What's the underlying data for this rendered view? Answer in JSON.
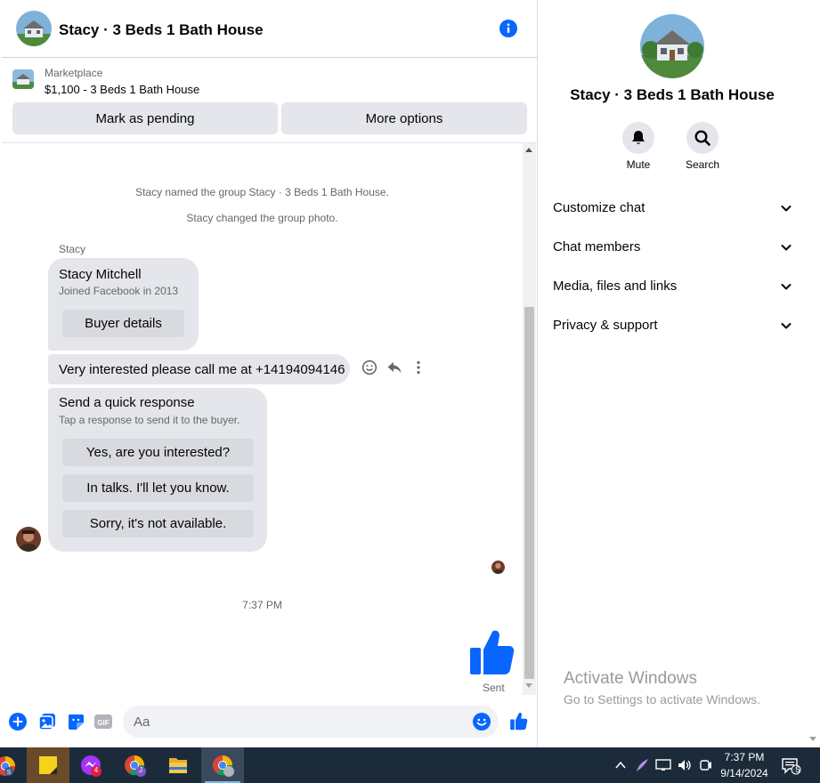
{
  "chat": {
    "title": "Stacy · 3 Beds 1 Bath House",
    "marketplace": {
      "label": "Marketplace",
      "listing": "$1,100 - 3 Beds 1 Bath House",
      "pending_label": "Mark as pending",
      "more_label": "More options"
    },
    "system_messages": [
      "Stacy named the group Stacy · 3 Beds 1 Bath House.",
      "Stacy changed the group photo."
    ],
    "sender_name": "Stacy",
    "profile_card": {
      "name": "Stacy Mitchell",
      "subtitle": "Joined Facebook in 2013",
      "button": "Buyer details"
    },
    "message_text": "Very interested please call me at +14194094146",
    "quick_response": {
      "title": "Send a quick response",
      "subtitle": "Tap a response to send it to the buyer.",
      "options": [
        "Yes, are you interested?",
        "In talks. I'll let you know.",
        "Sorry, it's not available."
      ]
    },
    "time_separator": "7:37 PM",
    "sent_label": "Sent",
    "composer_placeholder": "Aa"
  },
  "info_panel": {
    "title": "Stacy · 3 Beds 1 Bath House",
    "actions": [
      {
        "label": "Mute",
        "icon": "bell-icon"
      },
      {
        "label": "Search",
        "icon": "search-icon"
      }
    ],
    "sections": [
      "Customize chat",
      "Chat members",
      "Media, files and links",
      "Privacy & support"
    ]
  },
  "watermark": {
    "line1": "Activate Windows",
    "line2": "Go to Settings to activate Windows."
  },
  "taskbar": {
    "badge_count": "4",
    "chrome_profile_j": "J",
    "time": "7:37 PM",
    "date": "9/14/2024",
    "notifications": "5"
  },
  "colors": {
    "accent": "#0866ff",
    "bubble": "#e4e6eb",
    "taskbar": "#1c2b3a"
  }
}
